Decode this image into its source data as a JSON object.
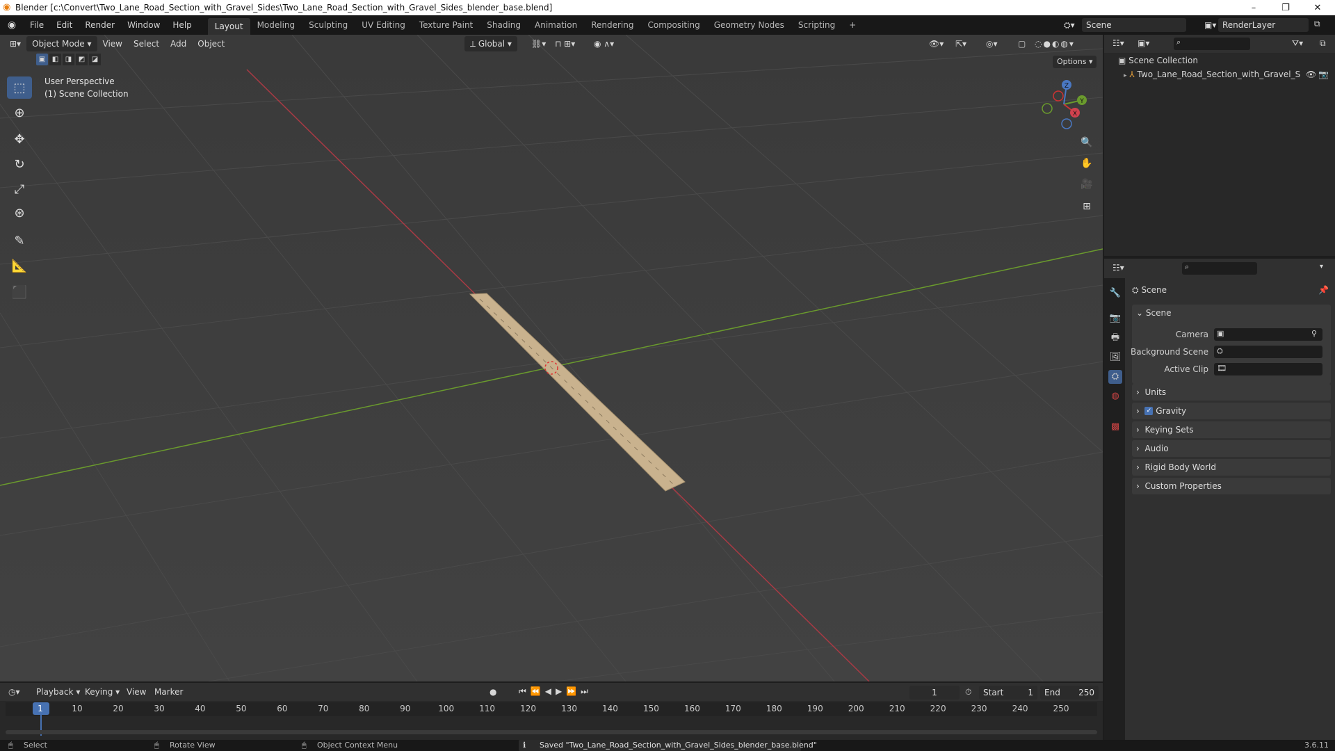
{
  "window": {
    "title": "Blender [c:\\Convert\\Two_Lane_Road_Section_with_Gravel_Sides\\Two_Lane_Road_Section_with_Gravel_Sides_blender_base.blend]",
    "minimize": "–",
    "maximize": "❐",
    "close": "✕"
  },
  "menus": [
    "File",
    "Edit",
    "Render",
    "Window",
    "Help"
  ],
  "workspaces": [
    "Layout",
    "Modeling",
    "Sculpting",
    "UV Editing",
    "Texture Paint",
    "Shading",
    "Animation",
    "Rendering",
    "Compositing",
    "Geometry Nodes",
    "Scripting",
    "+"
  ],
  "active_workspace_index": 0,
  "scene_selector": "Scene",
  "renderlayer_selector": "RenderLayer",
  "viewport": {
    "mode": "Object Mode",
    "menus": [
      "View",
      "Select",
      "Add",
      "Object"
    ],
    "orientation": "Global",
    "options_label": "Options",
    "overlay_line1": "User Perspective",
    "overlay_line2": "(1) Scene Collection",
    "gizmo_axes": {
      "x": "X",
      "y": "Y",
      "z": "Z"
    },
    "colors": {
      "x_axis": "#a83a44",
      "y_axis": "#6a9a2d",
      "road": "#c9b28e"
    }
  },
  "outliner": {
    "root": "Scene Collection",
    "items": [
      "Two_Lane_Road_Section_with_Gravel_S"
    ]
  },
  "properties": {
    "header": "Scene",
    "scene_panel": "Scene",
    "camera_label": "Camera",
    "background_scene_label": "Background Scene",
    "active_clip_label": "Active Clip",
    "panels": [
      "Units",
      "Gravity",
      "Keying Sets",
      "Audio",
      "Rigid Body World",
      "Custom Properties"
    ],
    "gravity_enabled": true
  },
  "timeline": {
    "menus": [
      "Playback",
      "Keying",
      "View",
      "Marker"
    ],
    "current_frame": "1",
    "start_label": "Start",
    "start_value": "1",
    "end_label": "End",
    "end_value": "250",
    "ticks": [
      "1",
      "10",
      "20",
      "30",
      "40",
      "50",
      "60",
      "70",
      "80",
      "90",
      "100",
      "110",
      "120",
      "130",
      "140",
      "150",
      "160",
      "170",
      "180",
      "190",
      "200",
      "210",
      "220",
      "230",
      "240",
      "250"
    ]
  },
  "status": {
    "select": "Select",
    "rotate": "Rotate View",
    "context": "Object Context Menu",
    "message": "Saved \"Two_Lane_Road_Section_with_Gravel_Sides_blender_base.blend\"",
    "version": "3.6.11"
  }
}
